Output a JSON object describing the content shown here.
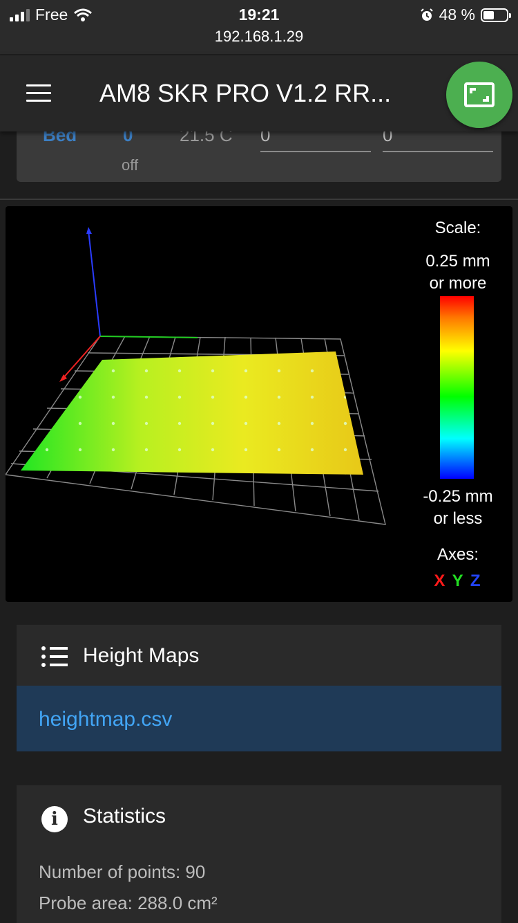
{
  "status_bar": {
    "carrier": "Free",
    "time": "19:21",
    "url": "192.168.1.29",
    "battery": "48 %",
    "icons": [
      "signal-icon",
      "wifi-icon",
      "alarm-icon",
      "battery-icon"
    ]
  },
  "app_bar": {
    "title": "AM8 SKR PRO V1.2 RR...",
    "menu_icon": "menu-icon",
    "fullscreen_icon": "fullscreen-icon",
    "fab_color": "#4caf50"
  },
  "heater": {
    "name": "Bed",
    "active": "0",
    "current": "21.5 C",
    "state": "off",
    "active_input": "0",
    "standby_input": "0"
  },
  "viewer": {
    "scale_title": "Scale:",
    "scale_max_line1": "0.25 mm",
    "scale_max_line2": "or more",
    "scale_min_line1": "-0.25 mm",
    "scale_min_line2": "or less",
    "axes_title": "Axes:",
    "axis_x": "X",
    "axis_y": "Y",
    "axis_z": "Z",
    "axis_colors": {
      "x": "#ff0000",
      "y": "#00ff00",
      "z": "#0000ff"
    }
  },
  "height_maps": {
    "title": "Height Maps",
    "files": [
      "heightmap.csv"
    ]
  },
  "statistics": {
    "title": "Statistics",
    "points": "Number of points: 90",
    "area": "Probe area: 288.0 cm²"
  }
}
